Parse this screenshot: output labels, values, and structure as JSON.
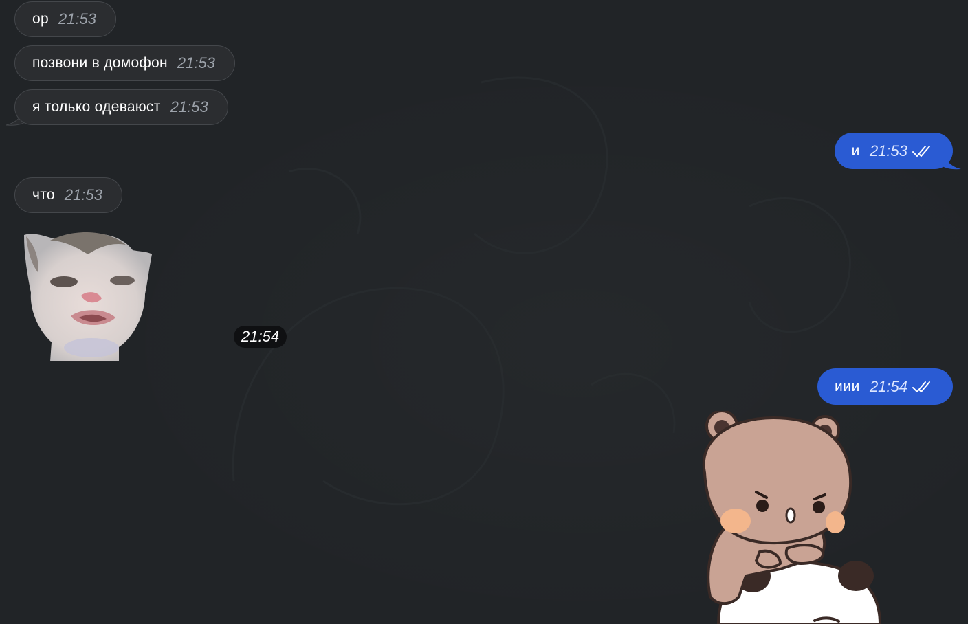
{
  "messages": [
    {
      "direction": "in",
      "text": "ор",
      "time": "21:53"
    },
    {
      "direction": "in",
      "text": "позвони в домофон",
      "time": "21:53"
    },
    {
      "direction": "in",
      "text": "я только одеваюст",
      "time": "21:53"
    },
    {
      "direction": "out",
      "text": "и",
      "time": "21:53",
      "status": "read"
    },
    {
      "direction": "in",
      "text": "что",
      "time": "21:53"
    },
    {
      "direction": "in",
      "type": "sticker",
      "sticker": "cat-face-sticker",
      "time": "21:54"
    },
    {
      "direction": "out",
      "text": "иии",
      "time": "21:54",
      "status": "read"
    },
    {
      "direction": "out",
      "type": "sticker",
      "sticker": "bear-on-panda-sticker"
    }
  ],
  "colors": {
    "background": "#212427",
    "incoming_bubble": "#2b2d30",
    "incoming_border": "#44474b",
    "outgoing_bubble": "#2a5bd3",
    "incoming_time": "#9da3ab",
    "outgoing_time": "#dde6ff"
  }
}
